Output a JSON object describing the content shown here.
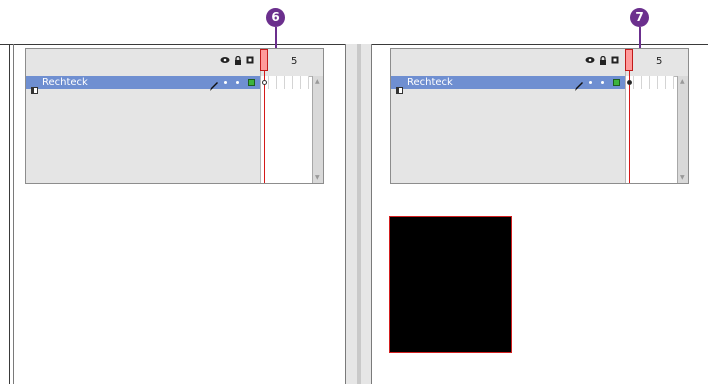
{
  "callouts": [
    "6",
    "7"
  ],
  "colors": {
    "callout": "#6b2f8d",
    "layer_selected": "#6f8fd1",
    "playhead": "#ff9a9a",
    "playline": "#d41a1a",
    "shape_fill": "#000000",
    "shape_stroke": "#d21f1f"
  },
  "panels": [
    {
      "layer_name": "Rechteck",
      "frame_label": "5",
      "header_icons": "eye-icon lock-icon outline-icon"
    },
    {
      "layer_name": "Rechteck",
      "frame_label": "5",
      "header_icons": "eye-icon lock-icon outline-icon"
    }
  ],
  "scroll": {
    "up": "▲",
    "down": "▼"
  }
}
